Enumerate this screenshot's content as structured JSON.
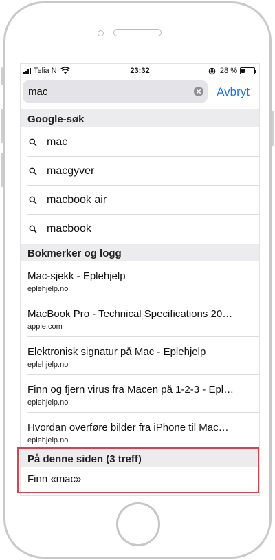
{
  "status_bar": {
    "carrier": "Telia N",
    "time": "23:32",
    "battery_percent": "28 %",
    "battery_level": 0.28
  },
  "search": {
    "query": "mac",
    "cancel_label": "Avbryt"
  },
  "google_section": {
    "header": "Google-søk",
    "suggestions": [
      {
        "label": "mac"
      },
      {
        "label": "macgyver"
      },
      {
        "label": "macbook air"
      },
      {
        "label": "macbook"
      }
    ]
  },
  "bookmarks_section": {
    "header": "Bokmerker og logg",
    "items": [
      {
        "title": "Mac-sjekk - Eplehjelp",
        "domain": "eplehjelp.no"
      },
      {
        "title": "MacBook Pro - Technical Specifications 20…",
        "domain": "apple.com"
      },
      {
        "title": "Elektronisk signatur på Mac - Eplehjelp",
        "domain": "eplehjelp.no"
      },
      {
        "title": "Finn og fjern virus fra Macen på 1-2-3 - Epl…",
        "domain": "eplehjelp.no"
      },
      {
        "title": "Hvordan overføre bilder fra iPhone til Mac…",
        "domain": "eplehjelp.no"
      }
    ]
  },
  "on_page_section": {
    "header": "På denne siden (3 treff)",
    "find_label": "Finn «mac»"
  },
  "colors": {
    "accent": "#1a73e8",
    "highlight": "#d0454f"
  }
}
